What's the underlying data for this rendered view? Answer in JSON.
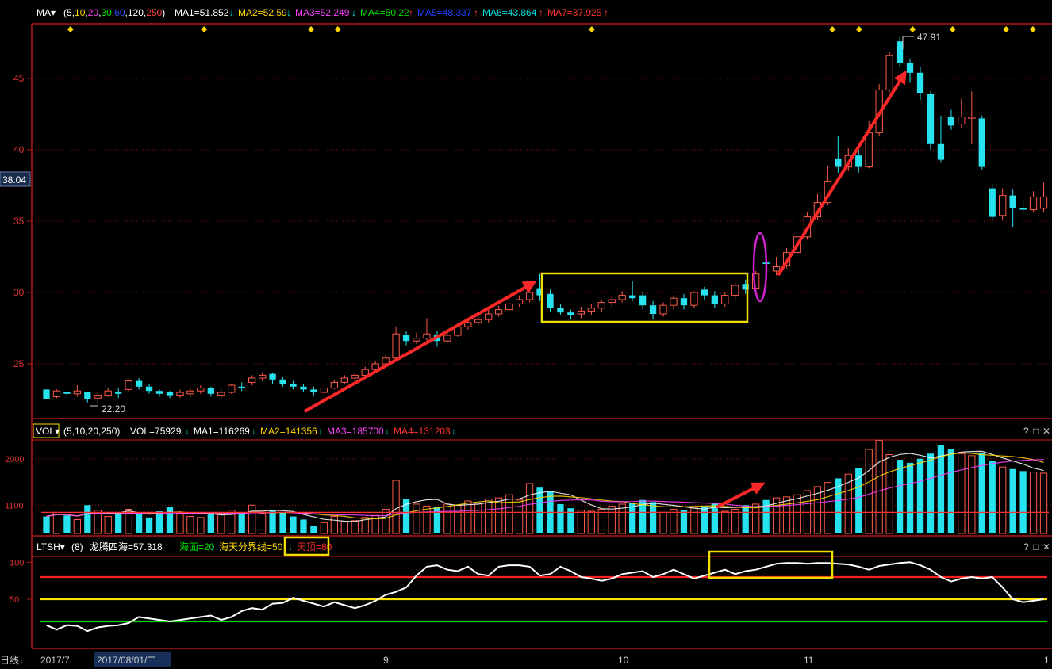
{
  "price_header": {
    "menu_label": "MA▾",
    "params_open": "(",
    "params": [
      {
        "text": "5",
        "color": "#ffffff"
      },
      {
        "text": "10",
        "color": "#ffd800"
      },
      {
        "text": "20",
        "color": "#ff40ff"
      },
      {
        "text": "30",
        "color": "#00e000"
      },
      {
        "text": "60",
        "color": "#3050ff"
      },
      {
        "text": "120",
        "color": "#ffffff"
      },
      {
        "text": "250",
        "color": "#ff4040"
      }
    ],
    "params_close": ")",
    "ma_items": [
      {
        "label": "MA1=51.852",
        "arrow": "↓",
        "color": "#ffffff",
        "arrow_color": "#00e0e0"
      },
      {
        "label": "MA2=52.59",
        "arrow": "↓",
        "color": "#ffd800",
        "arrow_color": "#00e0e0"
      },
      {
        "label": "MA3=52.249",
        "arrow": "↓",
        "color": "#ff40ff",
        "arrow_color": "#00e0e0"
      },
      {
        "label": "MA4=50.22",
        "arrow": "↑",
        "color": "#00e000",
        "arrow_color": "#ff4040"
      },
      {
        "label": "MA5=48.337",
        "arrow": "↑",
        "color": "#2040ff",
        "arrow_color": "#ff4040"
      },
      {
        "label": "MA6=43.864",
        "arrow": "↑",
        "color": "#00e0e0",
        "arrow_color": "#ff4040"
      },
      {
        "label": "MA7=37.925",
        "arrow": "↑",
        "color": "#ff3030",
        "arrow_color": "#ff4040"
      }
    ]
  },
  "vol_header": {
    "menu_label": "VOL▾",
    "params": "(5,10,20,250)",
    "items": [
      {
        "label": "VOL=75929",
        "arrow": "↓",
        "color": "#ffffff",
        "arrow_color": "#00e0e0"
      },
      {
        "label": "MA1=116269",
        "arrow": "↓",
        "color": "#ffffff",
        "arrow_color": "#00e0e0"
      },
      {
        "label": "MA2=141356",
        "arrow": "↓",
        "color": "#ffd800",
        "arrow_color": "#00e0e0"
      },
      {
        "label": "MA3=185700",
        "arrow": "↓",
        "color": "#ff40ff",
        "arrow_color": "#00e0e0"
      },
      {
        "label": "MA4=131203",
        "arrow": "↓",
        "color": "#ff3030",
        "arrow_color": "#00e0e0"
      }
    ]
  },
  "ind_header": {
    "menu_label": "LTSH▾",
    "params": "(8)",
    "main_label": "龙腾四海=57.318",
    "items": [
      {
        "label": "海面=20",
        "arrow": "↓",
        "color": "#00e000",
        "arrow_color": "#00e0e0"
      },
      {
        "label": "海天分界线=50",
        "arrow": "↓",
        "color": "#ffd800",
        "arrow_color": "#00e0e0"
      },
      {
        "label": "天顶=80",
        "arrow": "",
        "color": "#ff3030",
        "arrow_color": "#ff3030"
      }
    ]
  },
  "window_icons": [
    "?",
    "□",
    "✕"
  ],
  "price_label": "38.04",
  "bottom_axis": {
    "left_label": "日线↓",
    "month_start": "2017/7",
    "date_highlight": "2017/08/01/二",
    "months": [
      "9",
      "10",
      "11",
      "1"
    ]
  },
  "colors": {
    "up": "#ff5a4a",
    "down": "#27e3f0",
    "grid": "#8a1010",
    "frame": "#b01818",
    "highlight_box": "#f0e000",
    "ellipse": "#d020d0",
    "arrow": "#ff2828",
    "indicator_line": "#ffffff",
    "top_line": "#ff2020",
    "mid_line": "#ffe000",
    "bottom_line": "#00d000"
  },
  "chart_data": [
    {
      "type": "candlestick",
      "y_ticks": [
        25,
        30,
        35,
        40,
        45
      ],
      "ylim": [
        21.5,
        48.5
      ],
      "marker_count": 11,
      "annotations": [
        {
          "text": "22.20",
          "kind": "low"
        },
        {
          "text": "47.91",
          "kind": "high"
        }
      ],
      "candles": [
        [
          23.2,
          22.5,
          23.2,
          22.6
        ],
        [
          22.7,
          23.1,
          23.2,
          22.6
        ],
        [
          23.0,
          22.9,
          23.2,
          22.6
        ],
        [
          22.9,
          23.1,
          23.5,
          22.7
        ],
        [
          23.0,
          22.5,
          23.0,
          22.3
        ],
        [
          22.6,
          22.8,
          23.0,
          22.2
        ],
        [
          22.8,
          23.1,
          23.3,
          22.7
        ],
        [
          23.0,
          22.9,
          23.3,
          22.6
        ],
        [
          23.2,
          23.8,
          23.9,
          23.0
        ],
        [
          23.8,
          23.4,
          24.0,
          23.2
        ],
        [
          23.4,
          23.1,
          23.6,
          22.9
        ],
        [
          23.1,
          22.9,
          23.2,
          22.7
        ],
        [
          23.0,
          22.8,
          23.1,
          22.6
        ],
        [
          22.8,
          23.0,
          23.2,
          22.6
        ],
        [
          22.9,
          23.1,
          23.3,
          22.7
        ],
        [
          23.1,
          23.3,
          23.5,
          22.9
        ],
        [
          23.3,
          22.9,
          23.4,
          22.7
        ],
        [
          22.8,
          23.0,
          23.2,
          22.6
        ],
        [
          23.0,
          23.5,
          23.6,
          22.9
        ],
        [
          23.4,
          23.3,
          23.7,
          23.1
        ],
        [
          23.7,
          24.0,
          24.2,
          23.5
        ],
        [
          24.0,
          24.2,
          24.4,
          23.8
        ],
        [
          24.3,
          23.9,
          24.4,
          23.6
        ],
        [
          23.9,
          23.6,
          24.1,
          23.4
        ],
        [
          23.6,
          23.4,
          23.8,
          23.2
        ],
        [
          23.4,
          23.2,
          23.6,
          23.0
        ],
        [
          23.2,
          23.0,
          23.4,
          22.8
        ],
        [
          23.0,
          23.3,
          23.5,
          22.8
        ],
        [
          23.3,
          23.7,
          23.9,
          23.2
        ],
        [
          23.7,
          24.0,
          24.2,
          23.6
        ],
        [
          24.0,
          24.2,
          24.4,
          23.8
        ],
        [
          24.2,
          24.6,
          24.8,
          24.0
        ],
        [
          24.6,
          25.0,
          25.2,
          24.4
        ],
        [
          25.0,
          25.4,
          25.6,
          24.8
        ],
        [
          25.4,
          27.1,
          27.6,
          25.3
        ],
        [
          27.0,
          26.6,
          27.3,
          26.3
        ],
        [
          26.6,
          26.8,
          27.2,
          26.4
        ],
        [
          26.8,
          27.1,
          28.2,
          26.6
        ],
        [
          27.0,
          26.6,
          27.3,
          26.2
        ],
        [
          26.6,
          27.0,
          27.4,
          26.5
        ],
        [
          27.0,
          27.6,
          27.9,
          26.9
        ],
        [
          27.6,
          27.9,
          28.2,
          27.4
        ],
        [
          27.9,
          28.1,
          28.4,
          27.7
        ],
        [
          28.1,
          28.5,
          28.8,
          27.9
        ],
        [
          28.5,
          28.8,
          29.1,
          28.3
        ],
        [
          28.8,
          29.2,
          29.6,
          28.6
        ],
        [
          29.2,
          29.5,
          29.8,
          29.0
        ],
        [
          29.5,
          30.0,
          30.6,
          29.3
        ],
        [
          30.3,
          29.8,
          31.3,
          29.4
        ],
        [
          29.9,
          28.9,
          30.2,
          28.6
        ],
        [
          28.9,
          28.6,
          29.2,
          28.4
        ],
        [
          28.6,
          28.4,
          28.8,
          28.1
        ],
        [
          28.5,
          28.7,
          29.0,
          28.2
        ],
        [
          28.7,
          28.9,
          29.2,
          28.4
        ],
        [
          28.9,
          29.3,
          29.5,
          28.6
        ],
        [
          29.3,
          29.5,
          29.8,
          29.0
        ],
        [
          29.5,
          29.8,
          30.1,
          29.3
        ],
        [
          29.8,
          29.6,
          30.8,
          29.4
        ],
        [
          29.8,
          29.1,
          30.0,
          28.8
        ],
        [
          29.1,
          28.5,
          29.4,
          28.1
        ],
        [
          28.5,
          29.1,
          29.3,
          28.3
        ],
        [
          29.1,
          29.6,
          29.8,
          28.8
        ],
        [
          29.6,
          29.1,
          29.9,
          28.8
        ],
        [
          29.1,
          30.0,
          30.1,
          28.9
        ],
        [
          30.2,
          29.8,
          30.4,
          29.5
        ],
        [
          29.8,
          29.2,
          30.1,
          28.9
        ],
        [
          29.2,
          29.8,
          30.0,
          29.0
        ],
        [
          29.8,
          30.5,
          30.7,
          29.5
        ],
        [
          30.6,
          30.2,
          30.9,
          29.9
        ],
        [
          30.3,
          31.3,
          31.5,
          30.1
        ],
        [
          32.1,
          32.0,
          32.3,
          31.8
        ],
        [
          31.5,
          31.8,
          32.5,
          31.2
        ],
        [
          31.9,
          32.8,
          33.1,
          31.7
        ],
        [
          32.8,
          33.9,
          34.3,
          32.6
        ],
        [
          33.9,
          35.3,
          35.6,
          33.7
        ],
        [
          35.3,
          36.3,
          36.9,
          35.1
        ],
        [
          36.3,
          37.8,
          38.9,
          36.1
        ],
        [
          39.4,
          38.8,
          41.0,
          38.4
        ],
        [
          38.8,
          39.6,
          40.1,
          38.5
        ],
        [
          39.6,
          38.8,
          40.0,
          38.4
        ],
        [
          38.8,
          41.2,
          42.0,
          38.7
        ],
        [
          41.2,
          44.2,
          44.6,
          41.0
        ],
        [
          44.2,
          46.6,
          46.9,
          44.0
        ],
        [
          47.6,
          46.1,
          47.9,
          45.8
        ],
        [
          46.1,
          45.4,
          46.4,
          44.7
        ],
        [
          45.4,
          44.0,
          45.8,
          43.5
        ],
        [
          43.9,
          40.4,
          44.1,
          40.0
        ],
        [
          40.4,
          39.3,
          42.4,
          39.1
        ],
        [
          42.3,
          41.7,
          42.8,
          41.4
        ],
        [
          41.8,
          42.3,
          43.6,
          41.5
        ],
        [
          42.3,
          42.3,
          44.1,
          40.4
        ],
        [
          42.2,
          38.8,
          42.4,
          38.6
        ],
        [
          37.3,
          35.3,
          37.6,
          35.0
        ],
        [
          35.4,
          36.8,
          37.3,
          35.1
        ],
        [
          36.8,
          35.9,
          37.2,
          34.6
        ],
        [
          35.9,
          35.8,
          36.4,
          35.5
        ],
        [
          35.8,
          36.7,
          37.1,
          35.6
        ],
        [
          35.9,
          36.7,
          37.7,
          35.6
        ]
      ]
    },
    {
      "type": "bar",
      "title": "VOL",
      "y_ticks": [
        1100,
        2000
      ],
      "ylim": [
        550,
        2350
      ],
      "volumes": [
        880,
        960,
        900,
        820,
        1100,
        1000,
        880,
        940,
        1020,
        920,
        860,
        980,
        1060,
        940,
        880,
        860,
        940,
        920,
        1000,
        960,
        1100,
        940,
        1000,
        960,
        880,
        820,
        700,
        760,
        880,
        780,
        800,
        860,
        900,
        1020,
        1580,
        1220,
        1120,
        1080,
        1060,
        1120,
        1100,
        1180,
        1140,
        1220,
        1240,
        1300,
        1200,
        1520,
        1440,
        1380,
        1120,
        1040,
        1000,
        980,
        1020,
        1080,
        1120,
        1140,
        1200,
        1160,
        960,
        1020,
        1000,
        1060,
        1080,
        1140,
        980,
        1020,
        1100,
        1120,
        1200,
        1240,
        1260,
        1300,
        1380,
        1460,
        1540,
        1620,
        1700,
        1820,
        2180,
        2360,
        2080,
        1980,
        1920,
        2000,
        2100,
        2260,
        2180,
        2100,
        2060,
        2120,
        1960,
        1840,
        1800,
        1760,
        1740,
        1720
      ]
    },
    {
      "type": "line",
      "title": "LTSH",
      "y_ticks": [
        50,
        100
      ],
      "ylim": [
        -10,
        110
      ],
      "reference_lines": [
        80,
        50,
        20
      ],
      "values": [
        15,
        9,
        15,
        14,
        7,
        12,
        14,
        15,
        18,
        26,
        24,
        22,
        20,
        22,
        24,
        26,
        28,
        22,
        26,
        34,
        38,
        36,
        44,
        45,
        52,
        48,
        44,
        40,
        46,
        42,
        38,
        42,
        48,
        56,
        60,
        66,
        82,
        94,
        96,
        90,
        88,
        94,
        84,
        82,
        94,
        96,
        96,
        94,
        82,
        84,
        94,
        88,
        80,
        78,
        75,
        78,
        84,
        86,
        88,
        80,
        84,
        90,
        84,
        78,
        82,
        86,
        90,
        84,
        88,
        90,
        94,
        98,
        99,
        99,
        98,
        99,
        99,
        98,
        97,
        94,
        90,
        95,
        97,
        99,
        100,
        96,
        90,
        80,
        74,
        78,
        80,
        78,
        80,
        66,
        50,
        46,
        48,
        50
      ]
    }
  ]
}
